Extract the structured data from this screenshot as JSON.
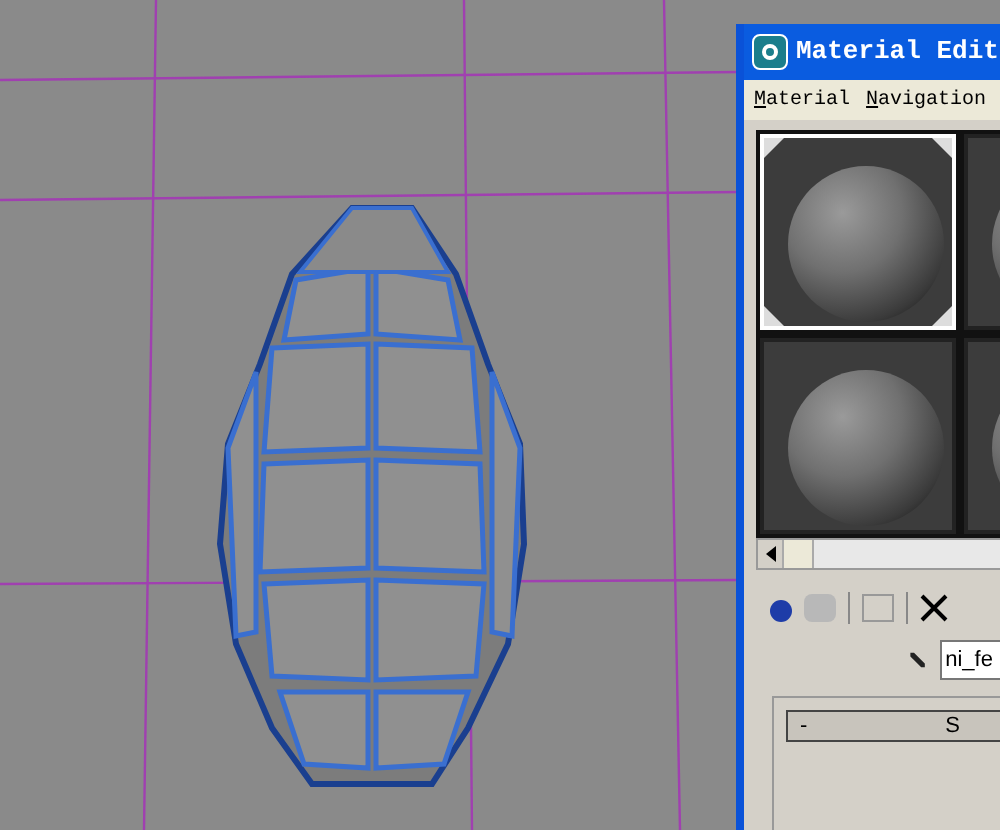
{
  "material_editor": {
    "title": "Material Edit",
    "menu": [
      {
        "label": "Material"
      },
      {
        "label": "Navigation"
      }
    ],
    "sample_slots": [
      {
        "selected": true
      },
      {
        "selected": false
      },
      {
        "selected": false
      },
      {
        "selected": false
      }
    ],
    "material_name": "ni_fe",
    "rollout": {
      "toggle": "-",
      "title": "S"
    }
  }
}
